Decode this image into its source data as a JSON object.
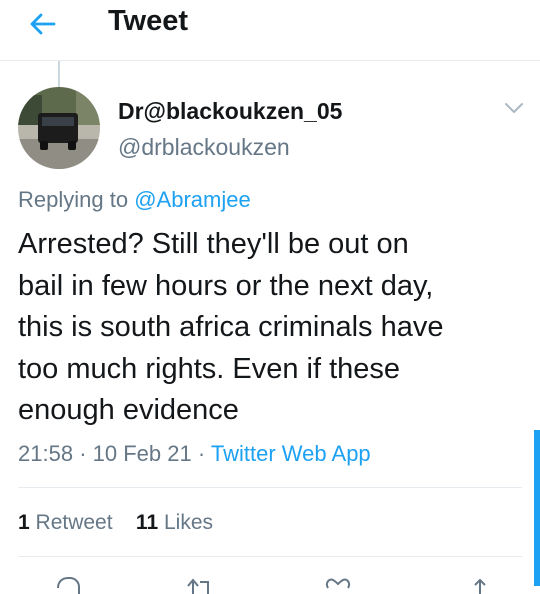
{
  "header": {
    "title": "Tweet"
  },
  "tweet": {
    "display_name": "Dr@blackoukzen_05",
    "handle": "@drblackoukzen",
    "replying_label": "Replying to",
    "replying_to": "@Abramjee",
    "text_lines": [
      "Arrested? Still they'll be out on",
      "bail in few hours or the next day,",
      "this is south africa criminals have",
      "too much rights. Even if these",
      "enough evidence"
    ],
    "time": "21:58",
    "separator": "·",
    "date": "10 Feb 21",
    "source": "Twitter Web App",
    "retweet_count": "1",
    "retweet_label": "Retweet",
    "like_count": "11",
    "like_label": "Likes"
  },
  "colors": {
    "accent": "#1da1f2",
    "secondary_text": "#657786",
    "divider": "#e6ecf0"
  },
  "icons": [
    "back-arrow-icon",
    "chevron-down-icon",
    "reply-icon",
    "retweet-icon",
    "like-icon",
    "share-icon"
  ]
}
